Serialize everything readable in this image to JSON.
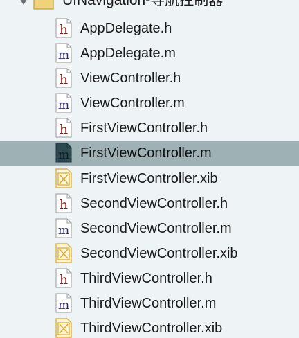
{
  "group": {
    "label": "UINavigation-导航控制器",
    "icon": "folder-icon",
    "expanded": true
  },
  "files": [
    {
      "name": "AppDelegate.h",
      "type": "h",
      "icon": "header-file-icon",
      "selected": false
    },
    {
      "name": "AppDelegate.m",
      "type": "m",
      "icon": "objc-source-file-icon",
      "selected": false
    },
    {
      "name": "ViewController.h",
      "type": "h",
      "icon": "header-file-icon",
      "selected": false
    },
    {
      "name": "ViewController.m",
      "type": "m",
      "icon": "objc-source-file-icon",
      "selected": false
    },
    {
      "name": "FirstViewController.h",
      "type": "h",
      "icon": "header-file-icon",
      "selected": false
    },
    {
      "name": "FirstViewController.m",
      "type": "m",
      "icon": "objc-source-file-icon",
      "selected": true
    },
    {
      "name": "FirstViewController.xib",
      "type": "xib",
      "icon": "xib-file-icon",
      "selected": false
    },
    {
      "name": "SecondViewController.h",
      "type": "h",
      "icon": "header-file-icon",
      "selected": false
    },
    {
      "name": "SecondViewController.m",
      "type": "m",
      "icon": "objc-source-file-icon",
      "selected": false
    },
    {
      "name": "SecondViewController.xib",
      "type": "xib",
      "icon": "xib-file-icon",
      "selected": false
    },
    {
      "name": "ThirdViewController.h",
      "type": "h",
      "icon": "header-file-icon",
      "selected": false
    },
    {
      "name": "ThirdViewController.m",
      "type": "m",
      "icon": "objc-source-file-icon",
      "selected": false
    },
    {
      "name": "ThirdViewController.xib",
      "type": "xib",
      "icon": "xib-file-icon",
      "selected": false
    }
  ],
  "colors": {
    "background": "#eef3f6",
    "selection": "#9eb2b6",
    "header_letter": "#8b1a1a",
    "source_letter": "#2a2a7a",
    "xib_accent": "#e0a521"
  }
}
